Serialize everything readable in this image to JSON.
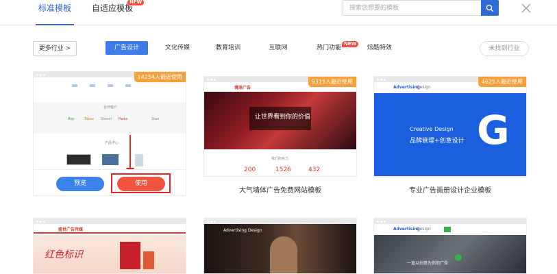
{
  "tabs": [
    {
      "label": "标准模板",
      "active": true
    },
    {
      "label": "自适应模板",
      "badge": "NEW"
    }
  ],
  "search": {
    "placeholder": "搜索您想要的模板"
  },
  "filter": {
    "more_label": "更多行业",
    "more_arrow": ">",
    "categories": [
      {
        "label": "广告设计",
        "active": true
      },
      {
        "label": "文化传媒"
      },
      {
        "label": "教育培训"
      },
      {
        "label": "互联网"
      },
      {
        "label": "热门功能",
        "badge": "NEW"
      },
      {
        "label": "炫酷特效"
      }
    ],
    "not_found_label": "未找到行业"
  },
  "cards": [
    {
      "usage": "14254人最近使用",
      "preview_label": "预览",
      "use_label": "使用",
      "section_partners": "合作客户",
      "section_products": "产品中心",
      "partner_logos": [
        "Rop",
        "Tobox",
        "Stoner",
        "Parks",
        "Stan"
      ]
    },
    {
      "usage": "9315人最近使用",
      "caption": "大气墙体广告免费网站模板",
      "brand": "博浪广告",
      "hero_text": "让世界看到你的价值",
      "section_title": "我们的实力",
      "stats": [
        "200",
        "1526",
        "432"
      ]
    },
    {
      "usage": "4625人最近使用",
      "caption": "专业广告画册设计企业模板",
      "brand": "Advertising",
      "brand_suffix": "Design",
      "hero_en": "Creative Design",
      "hero_cn": "品牌管理+创意设计",
      "hero_letter": "G"
    },
    {
      "brand": "盛世广告传媒",
      "hero_text": "红色标识"
    },
    {
      "brand": "Advertising Design"
    },
    {
      "brand": "Advertising",
      "brand_suffix": "Design",
      "hero_text": "一直以创意为你的广告"
    }
  ],
  "colors": {
    "primary": "#2f6bd8",
    "accent": "#f7a13a",
    "danger": "#e82424",
    "badge": "#ff4a3b"
  }
}
